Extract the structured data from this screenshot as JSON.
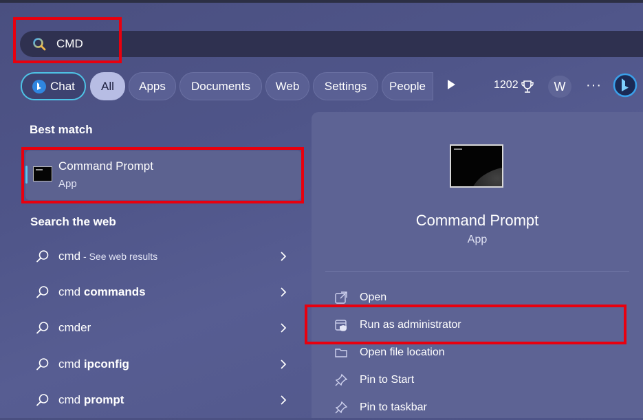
{
  "search": {
    "query": "CMD"
  },
  "filters": {
    "chat_label": "Chat",
    "tabs": [
      "All",
      "Apps",
      "Documents",
      "Web",
      "Settings",
      "People"
    ],
    "score": "1202",
    "profile_initial": "W",
    "more": "···"
  },
  "best_match": {
    "heading": "Best match",
    "name": "Command Prompt",
    "type": "App"
  },
  "search_web": {
    "heading": "Search the web",
    "rows": [
      {
        "prefix": "cmd",
        "bold": "",
        "sub": " - See web results"
      },
      {
        "prefix": "cmd ",
        "bold": "commands",
        "sub": ""
      },
      {
        "prefix": "cmder",
        "bold": "",
        "sub": ""
      },
      {
        "prefix": "cmd ",
        "bold": "ipconfig",
        "sub": ""
      },
      {
        "prefix": "cmd ",
        "bold": "prompt",
        "sub": ""
      }
    ]
  },
  "details": {
    "title": "Command Prompt",
    "type": "App",
    "actions": [
      "Open",
      "Run as administrator",
      "Open file location",
      "Pin to Start",
      "Pin to taskbar"
    ]
  },
  "colors": {
    "highlight_box": "#e8000e",
    "accent": "#5fc6ec",
    "all_pill": "#b7bde4"
  }
}
